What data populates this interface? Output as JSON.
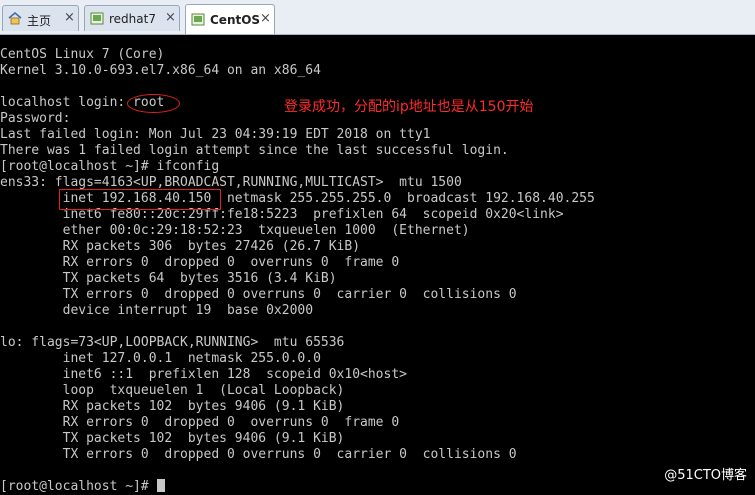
{
  "tabs": [
    {
      "label": "主页",
      "close": "×",
      "icon": "home-icon"
    },
    {
      "label": "redhat7",
      "close": "×",
      "icon": "vm-icon"
    },
    {
      "label": "CentOS",
      "close": "×",
      "icon": "vm-icon",
      "active": true
    }
  ],
  "terminal": {
    "lines": [
      "CentOS Linux 7 (Core)",
      "Kernel 3.10.0-693.el7.x86_64 on an x86_64",
      "",
      "localhost login: root",
      "Password:",
      "Last failed login: Mon Jul 23 04:39:19 EDT 2018 on tty1",
      "There was 1 failed login attempt since the last successful login.",
      "[root@localhost ~]# ifconfig",
      "ens33: flags=4163<UP,BROADCAST,RUNNING,MULTICAST>  mtu 1500",
      "        inet 192.168.40.150  netmask 255.255.255.0  broadcast 192.168.40.255",
      "        inet6 fe80::20c:29ff:fe18:5223  prefixlen 64  scopeid 0x20<link>",
      "        ether 00:0c:29:18:52:23  txqueuelen 1000  (Ethernet)",
      "        RX packets 306  bytes 27426 (26.7 KiB)",
      "        RX errors 0  dropped 0  overruns 0  frame 0",
      "        TX packets 64  bytes 3516 (3.4 KiB)",
      "        TX errors 0  dropped 0 overruns 0  carrier 0  collisions 0",
      "        device interrupt 19  base 0x2000",
      "",
      "lo: flags=73<UP,LOOPBACK,RUNNING>  mtu 65536",
      "        inet 127.0.0.1  netmask 255.0.0.0",
      "        inet6 ::1  prefixlen 128  scopeid 0x10<host>",
      "        loop  txqueuelen 1  (Local Loopback)",
      "        RX packets 102  bytes 9406 (9.1 KiB)",
      "        RX errors 0  dropped 0  overruns 0  frame 0",
      "        TX packets 102  bytes 9406 (9.1 KiB)",
      "        TX errors 0  dropped 0 overruns 0  carrier 0  collisions 0",
      "",
      "[root@localhost ~]# "
    ]
  },
  "annotation": {
    "text": "登录成功，分配的ip地址也是从150开始",
    "color": "#ff2a2a"
  },
  "watermark": "@51CTO博客"
}
